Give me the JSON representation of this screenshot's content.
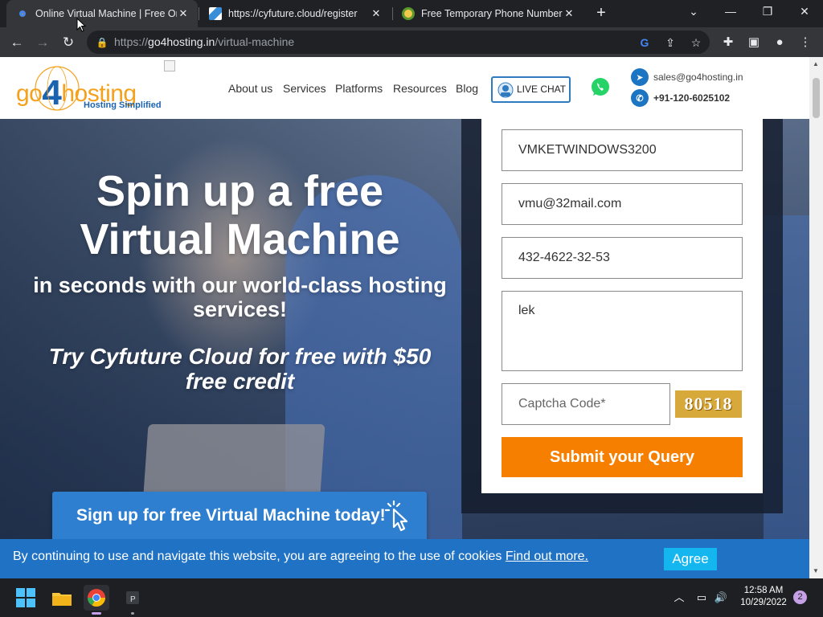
{
  "browser": {
    "tabs": [
      {
        "title": "Online Virtual Machine | Free Onl",
        "active": true
      },
      {
        "title": "https://cyfuture.cloud/register",
        "active": false
      },
      {
        "title": "Free Temporary Phone Numbers",
        "active": false
      }
    ],
    "url_prefix": "https://",
    "url_host": "go4hosting.in",
    "url_path": "/virtual-machine"
  },
  "site": {
    "logo_text_a": "go",
    "logo_text_b": "4",
    "logo_text_c": "hosting",
    "logo_tagline": "Hosting Simplified",
    "nav": [
      "About us",
      "Services",
      "Platforms",
      "Resources",
      "Blog"
    ],
    "live_chat": "LIVE CHAT",
    "email": "sales@go4hosting.in",
    "phone": "+91-120-6025102"
  },
  "hero": {
    "headline": "Spin up a free Virtual Machine",
    "subheadline": "in seconds with our world-class hosting services!",
    "offer": "Try Cyfuture Cloud for free with $50 free credit",
    "cta": "Sign up for free Virtual Machine today!"
  },
  "form": {
    "name_value": "VMKETWINDOWS3200",
    "email_value": "vmu@32mail.com",
    "phone_value": "432-4622-32-53",
    "message_value": "lek",
    "captcha_placeholder": "Captcha Code*",
    "captcha_image_text": "80518",
    "submit": "Submit your Query"
  },
  "cookie": {
    "text": "By continuing to use and navigate this website, you are agreeing to the use of cookies",
    "link": "Find out more.",
    "agree": "Agree"
  },
  "taskbar": {
    "time": "12:58 AM",
    "date": "10/29/2022",
    "notification_count": "2"
  },
  "colors": {
    "accent_orange": "#f77f00",
    "brand_blue": "#1f72c4",
    "cta_blue": "#2f7fd1",
    "whatsapp_green": "#25d366"
  }
}
